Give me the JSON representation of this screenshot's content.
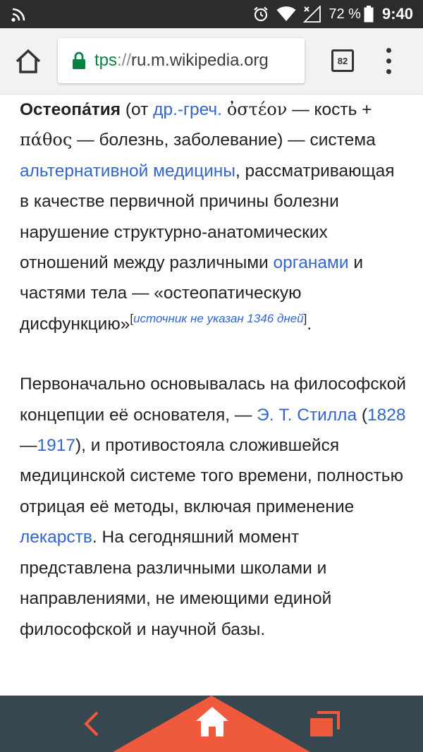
{
  "status_bar": {
    "battery_percent": "72 %",
    "time": "9:40",
    "icons": [
      "cast-icon",
      "alarm-icon",
      "wifi-icon",
      "signal-icon",
      "battery-icon"
    ]
  },
  "browser": {
    "url_scheme_fragment": "tps",
    "url_separator": "://",
    "url_host": "ru.m.wikipedia.org",
    "tab_count": "82",
    "icons": [
      "home-icon",
      "lock-icon",
      "overflow-menu-icon"
    ]
  },
  "article": {
    "p1": {
      "term": "Остеопа́тия",
      "t1": " (от ",
      "link_greek": "др.-греч.",
      "t2": " ",
      "greek1": "ὀστέον",
      "t3": " — кость + ",
      "greek2": "πάθος",
      "t4": " — болезнь, заболевание) — система ",
      "link_altmed": "альтернативной медицины",
      "t5": ", рассматривающая в качестве первичной причины болезни нарушение структурно-анатомических отношений между различными ",
      "link_organs": "органами",
      "t6": " и частями тела — «остеопатическую дисфункцию»",
      "ref_open": "[",
      "ref_text": "источник не указан 1346 дней",
      "ref_close": "]",
      "t7": "."
    },
    "p2": {
      "t1": "Первоначально основывалась на философской концепции её основателя, — ",
      "link_still": "Э. Т. Стилла",
      "t2": " (",
      "link_1828": "1828",
      "t3": "—",
      "link_1917": "1917",
      "t4": "), и противостояла сложившейся медицинской системе того времени, полностью отрицая её методы, включая применение ",
      "link_drugs": "лекарств",
      "t5": ". На сегодняшний момент представлена различными школами и направлениями, не имеющими единой философской и научной базы."
    }
  },
  "bottom_nav": {
    "icons": [
      "back-icon",
      "home-icon",
      "recents-icon"
    ],
    "colors": {
      "bar": "#37474f",
      "accent": "#f05a3c"
    }
  },
  "colors": {
    "status_bar": "#2c2c2c",
    "toolbar": "#f2f2f2",
    "link": "#3366cc",
    "secure": "#0b8043",
    "text": "#222222"
  }
}
